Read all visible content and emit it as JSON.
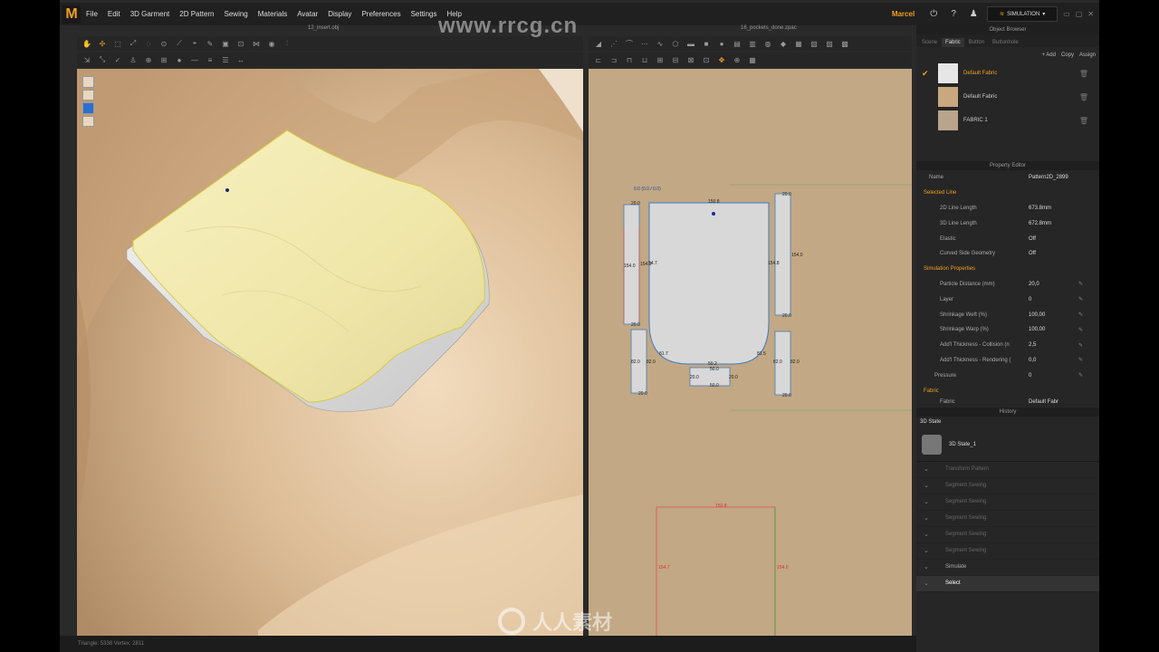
{
  "watermark": {
    "top": "www.rrcg.cn",
    "bottom": "人人素材"
  },
  "menu": {
    "logo": "M",
    "items": [
      "File",
      "Edit",
      "3D Garment",
      "2D Pattern",
      "Sewing",
      "Materials",
      "Avatar",
      "Display",
      "Preferences",
      "Settings",
      "Help"
    ],
    "user": "Marcel",
    "simulation": "SIMULATION"
  },
  "view3d": {
    "title": "12_insert.obj"
  },
  "view2d": {
    "title": "16_pockets_done.zpac",
    "coord": "0.0 (0.0 / 0.0)",
    "measures": {
      "top_width": "150.8",
      "left_h": "154.0",
      "inner_left": "154.0",
      "left_small": "54.7",
      "right_h": "154.0",
      "right_inner": "154.8",
      "top_left": "20.0",
      "top_right": "20.0",
      "mid_left": "20.0",
      "mid_right": "20.0",
      "lower_left_h": "82.0",
      "lower_left_in": "82.0",
      "lower_right_h": "82.0",
      "lower_right_in": "82.0",
      "curve_left": "81.7",
      "curve_right": "81.5",
      "bottom_top": "50.2",
      "bottom_mid": "50.0",
      "bottom_left": "20.0",
      "bottom_right": "20.0",
      "bottom_bot": "50.0",
      "bl_corner": "20.0",
      "br_corner": "20.0",
      "lower_width": "150.8",
      "lower_left": "154.7",
      "lower_right": "154.0"
    }
  },
  "object_browser": {
    "title": "Object Browser",
    "tabs": [
      "Scene",
      "Fabric",
      "Button",
      "Buttonhole"
    ],
    "add": "+ Add",
    "copy": "Copy",
    "assign": "Assign",
    "fabrics": [
      {
        "name": "Default Fabric",
        "color": "#e6e6e6",
        "active": true
      },
      {
        "name": "Default Fabric",
        "color": "#c9a87f",
        "active": false
      },
      {
        "name": "FABRIC 1",
        "color": "#b9a48c",
        "active": false
      }
    ]
  },
  "property_editor": {
    "title": "Property Editor",
    "name_label": "Name",
    "name_value": "Pattern2D_2899",
    "selected_line": "Selected Line",
    "rows_line": [
      {
        "label": "2D Line Length",
        "value": "673.8mm"
      },
      {
        "label": "3D Line Length",
        "value": "672.8mm"
      },
      {
        "label": "Elastic",
        "value": "Off"
      },
      {
        "label": "Curved Side Geometry",
        "value": "Off"
      }
    ],
    "sim_props": "Simulation Properties",
    "rows_sim": [
      {
        "label": "Particle Distance (mm)",
        "value": "20,0"
      },
      {
        "label": "Layer",
        "value": "0"
      },
      {
        "label": "Shrinkage Weft (%)",
        "value": "100,00"
      },
      {
        "label": "Shrinkage Warp (%)",
        "value": "100,00"
      },
      {
        "label": "Add'l Thickness - Collision (n",
        "value": "2,5"
      },
      {
        "label": "Add'l Thickness - Rendering (",
        "value": "0,0"
      },
      {
        "label": "Pressure",
        "value": "0"
      }
    ],
    "fabric_section": "Fabric",
    "fabric_label": "Fabric",
    "fabric_value": "Default Fabr"
  },
  "history": {
    "title": "History",
    "state_label": "3D State",
    "state_item": "3D State_1",
    "items": [
      "Transform Pattern",
      "Segment Sewing",
      "Segment Sewing",
      "Segment Sewing",
      "Segment Sewing",
      "Segment Sewing",
      "Simulate",
      "Select"
    ]
  },
  "status": {
    "text": "Triangle: 5338    Vertex: 2811"
  }
}
